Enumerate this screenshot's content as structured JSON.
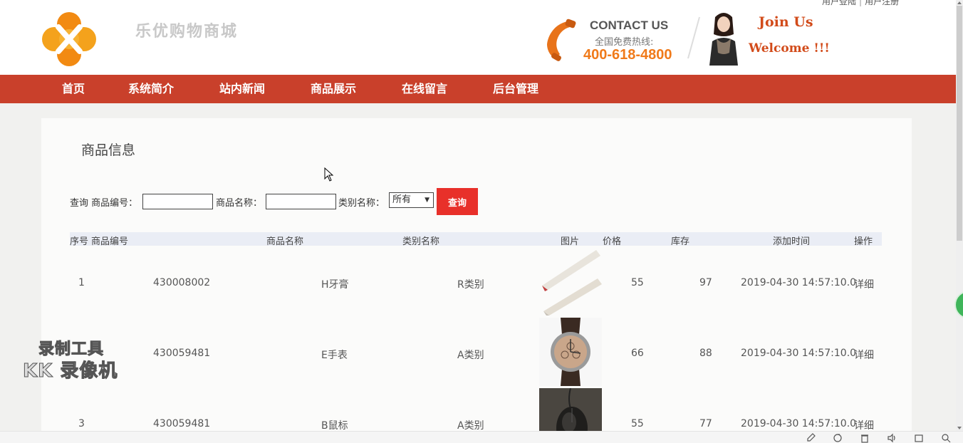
{
  "header": {
    "top_links": [
      "用户登陆",
      "用户注册"
    ],
    "site_title": "乐优购物商城",
    "contact_title": "CONTACT US",
    "contact_sub": "全国免费热线:",
    "contact_phone": "400-618-4800",
    "join_line1": "Join Us",
    "join_line2": "Welcome !!!"
  },
  "nav": [
    "首页",
    "系统简介",
    "站内新闻",
    "商品展示",
    "在线留言",
    "后台管理"
  ],
  "panel": {
    "title": "商品信息",
    "search": {
      "label_query": "查询 商品编号：",
      "label_name": "商品名称：",
      "label_category": "类别名称：",
      "category_selected": "所有",
      "button": "查询"
    },
    "columns": [
      "序号",
      "商品编号",
      "商品名称",
      "类别名称",
      "图片",
      "价格",
      "库存",
      "添加时间",
      "操作"
    ],
    "rows": [
      {
        "no": "1",
        "code": "430008002",
        "name": "H牙膏",
        "category": "R类别",
        "image": "toothpaste",
        "price": "55",
        "stock": "97",
        "time": "2019-04-30 14:57:10.0",
        "action": "详细"
      },
      {
        "no": "",
        "code": "430059481",
        "name": "E手表",
        "category": "A类别",
        "image": "watch",
        "price": "66",
        "stock": "88",
        "time": "2019-04-30 14:57:10.0",
        "action": "详细"
      },
      {
        "no": "3",
        "code": "430059481",
        "name": "B鼠标",
        "category": "A类别",
        "image": "mouse",
        "price": "55",
        "stock": "77",
        "time": "2019-04-30 14:57:10.0",
        "action": "详细"
      }
    ]
  },
  "watermark": {
    "line1": "录制工具",
    "line2": "KK 录像机"
  },
  "colors": {
    "nav_bg": "#c9402b",
    "button_bg": "#e8302a",
    "phone_orange": "#f07a1a",
    "join_red": "#d24b1a"
  },
  "toolbar_icons": [
    "rocket-icon",
    "refresh-icon",
    "trash-icon",
    "volume-icon",
    "window-icon",
    "search-icon"
  ]
}
